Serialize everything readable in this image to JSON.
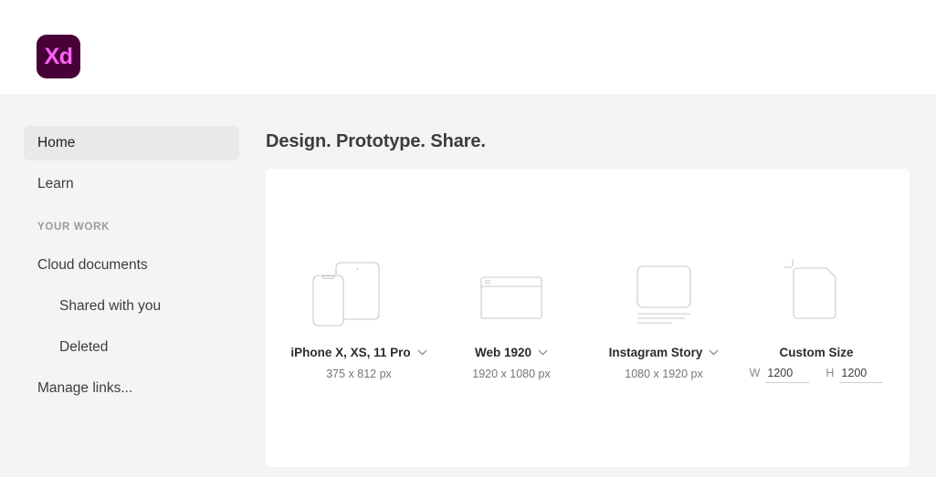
{
  "app": {
    "logo_text": "Xd",
    "logo_bg": "#470137",
    "logo_fg": "#ff61f6"
  },
  "sidebar": {
    "section_label": "YOUR WORK",
    "items": [
      {
        "label": "Home",
        "selected": true,
        "indent": false
      },
      {
        "label": "Learn",
        "selected": false,
        "indent": false
      },
      {
        "label": "Cloud documents",
        "selected": false,
        "indent": false
      },
      {
        "label": "Shared with you",
        "selected": false,
        "indent": true
      },
      {
        "label": "Deleted",
        "selected": false,
        "indent": true
      },
      {
        "label": "Manage links...",
        "selected": false,
        "indent": false
      }
    ]
  },
  "main": {
    "title": "Design. Prototype. Share.",
    "presets": [
      {
        "name": "iPhone X, XS, 11 Pro",
        "dims": "375 x 812 px",
        "icon": "phone-tablet-icon",
        "has_chevron": true
      },
      {
        "name": "Web 1920",
        "dims": "1920 x 1080 px",
        "icon": "browser-window-icon",
        "has_chevron": true
      },
      {
        "name": "Instagram Story",
        "dims": "1080 x 1920 px",
        "icon": "social-story-icon",
        "has_chevron": true
      },
      {
        "name": "Custom Size",
        "icon": "artboard-icon",
        "has_chevron": false,
        "width_label": "W",
        "width_value": "1200",
        "height_label": "H",
        "height_value": "1200"
      }
    ]
  },
  "colors": {
    "page_bg": "#f4f4f4",
    "card_bg": "#ffffff",
    "selected_bg": "#e9e9e9",
    "icon_stroke": "#c8c8c8",
    "muted_text": "#757575"
  }
}
